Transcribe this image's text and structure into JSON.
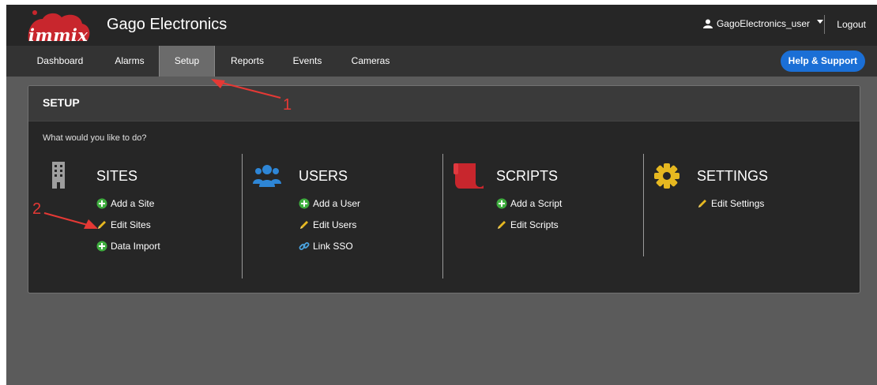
{
  "header": {
    "logo_text": "immix",
    "company": "Gago Electronics",
    "user": "GagoElectronics_user",
    "logout": "Logout"
  },
  "nav": {
    "items": [
      "Dashboard",
      "Alarms",
      "Setup",
      "Reports",
      "Events",
      "Cameras"
    ],
    "active": "Setup",
    "help": "Help & Support"
  },
  "panel": {
    "title": "SETUP",
    "prompt": "What would you like to do?",
    "columns": [
      {
        "title": "SITES",
        "icon": "building-icon",
        "links": [
          {
            "label": "Add a Site",
            "icon": "plus-circle-icon"
          },
          {
            "label": "Edit Sites",
            "icon": "pencil-icon"
          },
          {
            "label": "Data Import",
            "icon": "plus-circle-icon"
          }
        ]
      },
      {
        "title": "USERS",
        "icon": "users-icon",
        "links": [
          {
            "label": "Add a User",
            "icon": "plus-circle-icon"
          },
          {
            "label": "Edit Users",
            "icon": "pencil-icon"
          },
          {
            "label": "Link SSO",
            "icon": "link-icon"
          }
        ]
      },
      {
        "title": "SCRIPTS",
        "icon": "scroll-icon",
        "links": [
          {
            "label": "Add a Script",
            "icon": "plus-circle-icon"
          },
          {
            "label": "Edit Scripts",
            "icon": "pencil-icon"
          }
        ]
      },
      {
        "title": "SETTINGS",
        "icon": "gear-icon",
        "links": [
          {
            "label": "Edit Settings",
            "icon": "pencil-icon"
          }
        ]
      }
    ]
  },
  "annotations": {
    "first": "1",
    "second": "2"
  },
  "colors": {
    "accent": "#1b6fd6",
    "plus": "#3fae3f",
    "pencil": "#e6b820",
    "link": "#4aa3df",
    "scripts": "#c8262d",
    "settings": "#e6b820",
    "users": "#2e86d6",
    "annotation": "#e53935"
  }
}
